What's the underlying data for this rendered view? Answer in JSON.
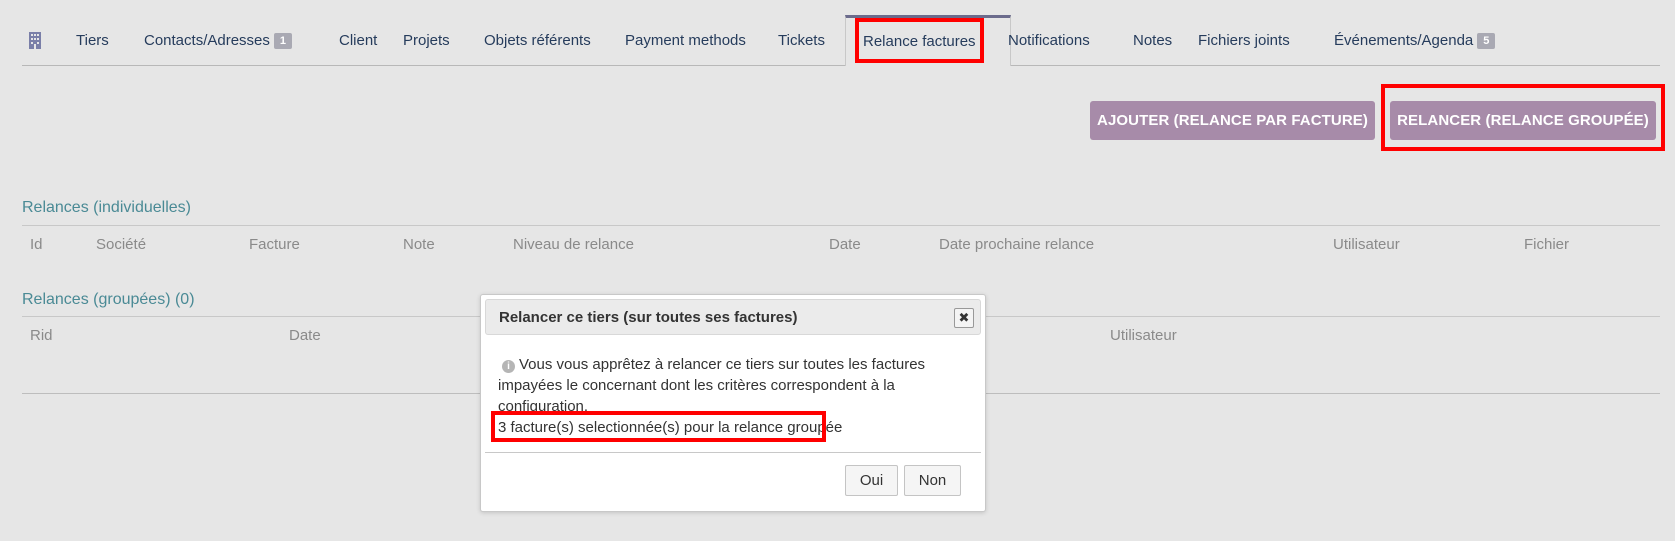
{
  "tabs": [
    {
      "label": "Tiers"
    },
    {
      "label": "Contacts/Adresses",
      "badge": "1"
    },
    {
      "label": "Client"
    },
    {
      "label": "Projets"
    },
    {
      "label": "Objets référents"
    },
    {
      "label": "Payment methods"
    },
    {
      "label": "Tickets"
    },
    {
      "label": "Relance factures",
      "active": true
    },
    {
      "label": "Notifications"
    },
    {
      "label": "Notes"
    },
    {
      "label": "Fichiers joints"
    },
    {
      "label": "Événements/Agenda",
      "badge": "5"
    }
  ],
  "actions": {
    "add_label": "AJOUTER (RELANCE PAR FACTURE)",
    "group_label": "RELANCER (RELANCE GROUPÉE)"
  },
  "individual": {
    "title": "Relances (individuelles)",
    "columns": [
      "Id",
      "Société",
      "Facture",
      "Note",
      "Niveau de relance",
      "Date",
      "Date prochaine relance",
      "Utilisateur",
      "Fichier"
    ]
  },
  "grouped": {
    "title": "Relances (groupées) (0)",
    "columns": [
      "Rid",
      "Date",
      "Utilisateur"
    ]
  },
  "dialog": {
    "title": "Relancer ce tiers (sur toutes ses factures)",
    "close_glyph": "✖",
    "info_glyph": "i",
    "message": "Vous vous apprêtez à relancer ce tiers sur toutes les factures impayées le concernant dont les critères correspondent à la configuration.",
    "selection": "3 facture(s) selectionnée(s) pour la relance groupée",
    "yes_label": "Oui",
    "no_label": "Non"
  },
  "colors": {
    "accent_purple": "#a78ba9",
    "section_teal": "#4a8a95",
    "highlight_red": "#ff0000"
  }
}
